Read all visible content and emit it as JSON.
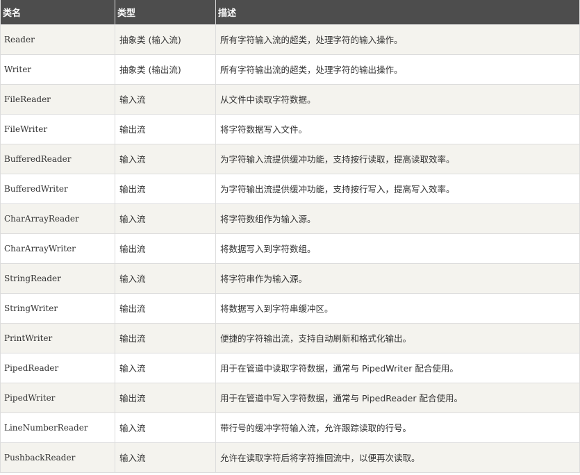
{
  "table": {
    "headers": [
      "类名",
      "类型",
      "描述"
    ],
    "rows": [
      {
        "name": "Reader",
        "type": "抽象类 (输入流)",
        "desc": "所有字符输入流的超类，处理字符的输入操作。"
      },
      {
        "name": "Writer",
        "type": "抽象类 (输出流)",
        "desc": "所有字符输出流的超类，处理字符的输出操作。"
      },
      {
        "name": "FileReader",
        "type": "输入流",
        "desc": "从文件中读取字符数据。"
      },
      {
        "name": "FileWriter",
        "type": "输出流",
        "desc": "将字符数据写入文件。"
      },
      {
        "name": "BufferedReader",
        "type": "输入流",
        "desc": "为字符输入流提供缓冲功能，支持按行读取，提高读取效率。"
      },
      {
        "name": "BufferedWriter",
        "type": "输出流",
        "desc": "为字符输出流提供缓冲功能，支持按行写入，提高写入效率。"
      },
      {
        "name": "CharArrayReader",
        "type": "输入流",
        "desc": "将字符数组作为输入源。"
      },
      {
        "name": "CharArrayWriter",
        "type": "输出流",
        "desc": "将数据写入到字符数组。"
      },
      {
        "name": "StringReader",
        "type": "输入流",
        "desc": "将字符串作为输入源。"
      },
      {
        "name": "StringWriter",
        "type": "输出流",
        "desc": "将数据写入到字符串缓冲区。"
      },
      {
        "name": "PrintWriter",
        "type": "输出流",
        "desc": "便捷的字符输出流，支持自动刷新和格式化输出。"
      },
      {
        "name": "PipedReader",
        "type": "输入流",
        "desc": "用于在管道中读取字符数据，通常与 PipedWriter 配合使用。"
      },
      {
        "name": "PipedWriter",
        "type": "输出流",
        "desc": "用于在管道中写入字符数据，通常与 PipedReader 配合使用。"
      },
      {
        "name": "LineNumberReader",
        "type": "输入流",
        "desc": "带行号的缓冲字符输入流，允许跟踪读取的行号。"
      },
      {
        "name": "PushbackReader",
        "type": "输入流",
        "desc": "允许在读取字符后将字符推回流中，以便再次读取。"
      }
    ]
  }
}
